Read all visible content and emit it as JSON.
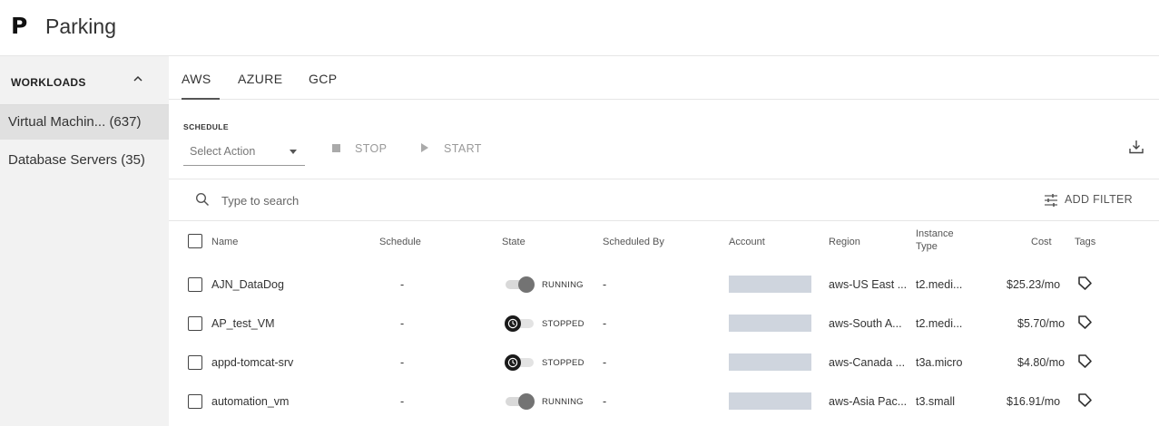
{
  "header": {
    "logo": "P",
    "title": "Parking"
  },
  "sidebar": {
    "section_title": "WORKLOADS",
    "items": [
      {
        "label": "Virtual Machin... (637)",
        "active": true
      },
      {
        "label": "Database Servers (35)",
        "active": false
      }
    ]
  },
  "tabs": [
    {
      "label": "AWS",
      "active": true
    },
    {
      "label": "AZURE",
      "active": false
    },
    {
      "label": "GCP",
      "active": false
    }
  ],
  "toolbar": {
    "schedule_label": "SCHEDULE",
    "select_value": "Select Action",
    "stop_label": "STOP",
    "start_label": "START"
  },
  "search": {
    "placeholder": "Type to search",
    "add_filter_label": "ADD FILTER"
  },
  "table": {
    "headers": {
      "name": "Name",
      "schedule": "Schedule",
      "state": "State",
      "scheduled_by": "Scheduled By",
      "account": "Account",
      "region": "Region",
      "instance_type_1": "Instance",
      "instance_type_2": "Type",
      "cost": "Cost",
      "tags": "Tags"
    },
    "rows": [
      {
        "name": "AJN_DataDog",
        "schedule": "-",
        "state": "RUNNING",
        "running": true,
        "scheduled_by": "-",
        "region": "aws-US East ...",
        "instance_type": "t2.medi...",
        "cost": "$25.23/mo"
      },
      {
        "name": "AP_test_VM",
        "schedule": "-",
        "state": "STOPPED",
        "running": false,
        "scheduled_by": "-",
        "region": "aws-South A...",
        "instance_type": "t2.medi...",
        "cost": "$5.70/mo"
      },
      {
        "name": "appd-tomcat-srv",
        "schedule": "-",
        "state": "STOPPED",
        "running": false,
        "scheduled_by": "-",
        "region": "aws-Canada ...",
        "instance_type": "t3a.micro",
        "cost": "$4.80/mo"
      },
      {
        "name": "automation_vm",
        "schedule": "-",
        "state": "RUNNING",
        "running": true,
        "scheduled_by": "-",
        "region": "aws-Asia Pac...",
        "instance_type": "t3.small",
        "cost": "$16.91/mo"
      }
    ]
  },
  "colors": {
    "toggle_on_track": "#d9d9d9",
    "toggle_on_knob": "#737373",
    "toggle_off_knob": "#1a1a1a",
    "account_redacted": "#cfd5de"
  },
  "icons": [
    "chevron-up-icon",
    "download-icon",
    "search-icon",
    "filter-sliders-icon",
    "tag-icon",
    "stop-square-icon",
    "play-triangle-icon",
    "dropdown-caret-icon",
    "clock-icon"
  ]
}
